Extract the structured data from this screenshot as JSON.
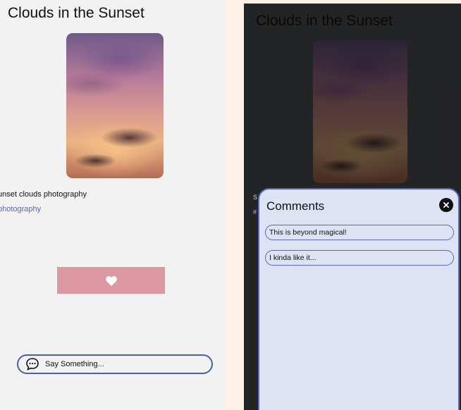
{
  "post": {
    "title": "Clouds in the Sunset",
    "description": "unset clouds photography",
    "hashtag": "photography"
  },
  "like_button": {
    "icon": "heart-icon",
    "color": "#dc98a2"
  },
  "say_bar": {
    "icon": "chat-bubble-icon",
    "placeholder": "Say Something..."
  },
  "comments_panel": {
    "peek_desc": "S",
    "peek_tag": "#",
    "title": "Comments",
    "close_icon": "close-icon",
    "items": [
      {
        "text": "This is beyond magical!"
      },
      {
        "text": "I kinda like it..."
      }
    ]
  },
  "colors": {
    "accent": "#5b69b9",
    "link": "#5567b5",
    "sheet_bg": "#dde3f4"
  }
}
